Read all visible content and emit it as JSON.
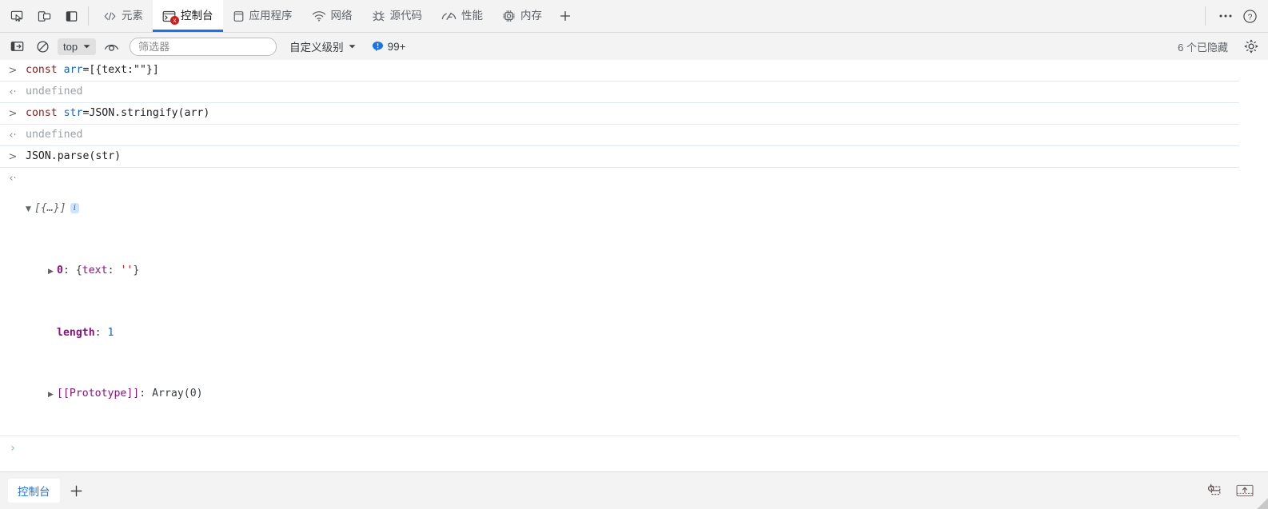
{
  "tabbar": {
    "left_icons": [
      {
        "name": "inspect-element-icon",
        "title": "检查元素"
      },
      {
        "name": "device-toolbar-icon",
        "title": "设备模拟"
      },
      {
        "name": "dock-side-icon",
        "title": "停靠方位"
      }
    ],
    "tabs": [
      {
        "label": "元素",
        "icon": "code-brackets-icon",
        "active": false
      },
      {
        "label": "控制台",
        "icon": "console-terminal-icon",
        "active": true,
        "error_badge": "x"
      },
      {
        "label": "应用程序",
        "icon": "application-storage-icon",
        "active": false
      },
      {
        "label": "网络",
        "icon": "network-wifi-icon",
        "active": false
      },
      {
        "label": "源代码",
        "icon": "sources-bug-icon",
        "active": false
      },
      {
        "label": "性能",
        "icon": "performance-gauge-icon",
        "active": false
      },
      {
        "label": "内存",
        "icon": "memory-chip-icon",
        "active": false
      }
    ],
    "add_tab_label": "+",
    "more_label": "···",
    "help_label": "?"
  },
  "toolbar": {
    "sidebar_toggle": "console-sidebar-icon",
    "clear_console": "clear-console-icon",
    "context": "top",
    "eye_icon": "live-expression-icon",
    "filter_placeholder": "筛选器",
    "filter_value": "",
    "level_label": "自定义级别",
    "issues_count": "99+",
    "hidden_count": "6 个已隐藏",
    "settings_icon": "settings-gear-icon"
  },
  "console": {
    "entries": [
      {
        "type": "input",
        "gutter": ">",
        "tokens": [
          {
            "cls": "kw",
            "t": "const"
          },
          {
            "cls": "plain",
            "t": " "
          },
          {
            "cls": "var",
            "t": "arr"
          },
          {
            "cls": "plain",
            "t": "=[{text:\"\"}]"
          }
        ]
      },
      {
        "type": "output",
        "gutter": "‹·",
        "tokens": [
          {
            "cls": "und",
            "t": "undefined"
          }
        ]
      },
      {
        "type": "input",
        "gutter": ">",
        "tokens": [
          {
            "cls": "kw",
            "t": "const"
          },
          {
            "cls": "plain",
            "t": " "
          },
          {
            "cls": "var",
            "t": "str"
          },
          {
            "cls": "plain",
            "t": "=JSON.stringify(arr)"
          }
        ]
      },
      {
        "type": "output",
        "gutter": "‹·",
        "tokens": [
          {
            "cls": "und",
            "t": "undefined"
          }
        ]
      },
      {
        "type": "input",
        "gutter": ">",
        "tokens": [
          {
            "cls": "plain",
            "t": "JSON.parse(str)"
          }
        ]
      }
    ],
    "result": {
      "gutter": "‹·",
      "disclosure": "▼",
      "preview": "[{…}]",
      "info_badge": "i",
      "children": [
        {
          "disclosure": "▶",
          "tokens": [
            {
              "cls": "prop",
              "t": "0"
            },
            {
              "cls": "grey",
              "t": ": "
            },
            {
              "cls": "grey",
              "t": "{"
            },
            {
              "cls": "propn",
              "t": "text"
            },
            {
              "cls": "grey",
              "t": ": "
            },
            {
              "cls": "str",
              "t": "''"
            },
            {
              "cls": "grey",
              "t": "}"
            }
          ]
        },
        {
          "disclosure": "",
          "tokens": [
            {
              "cls": "prop",
              "t": "length"
            },
            {
              "cls": "grey",
              "t": ": "
            },
            {
              "cls": "num",
              "t": "1"
            }
          ]
        },
        {
          "disclosure": "▶",
          "tokens": [
            {
              "cls": "propn",
              "t": "[[Prototype]]"
            },
            {
              "cls": "grey",
              "t": ": "
            },
            {
              "cls": "grey",
              "t": "Array(0)"
            }
          ]
        }
      ]
    },
    "prompt": {
      "gutter": "›",
      "value": ""
    }
  },
  "drawer": {
    "tab_label": "控制台",
    "add_label": "+",
    "right_icons": [
      {
        "name": "restore-drawer-icon"
      },
      {
        "name": "dock-bottom-icon"
      }
    ]
  },
  "colors": {
    "accent": "#1a73e8",
    "error": "#c5221f",
    "toolbar_bg": "#f3f3f3",
    "separator": "#e0e8f2",
    "keyword": "#8b1a1a",
    "property": "#881280",
    "string": "#c41a16",
    "number": "#1565c0"
  }
}
